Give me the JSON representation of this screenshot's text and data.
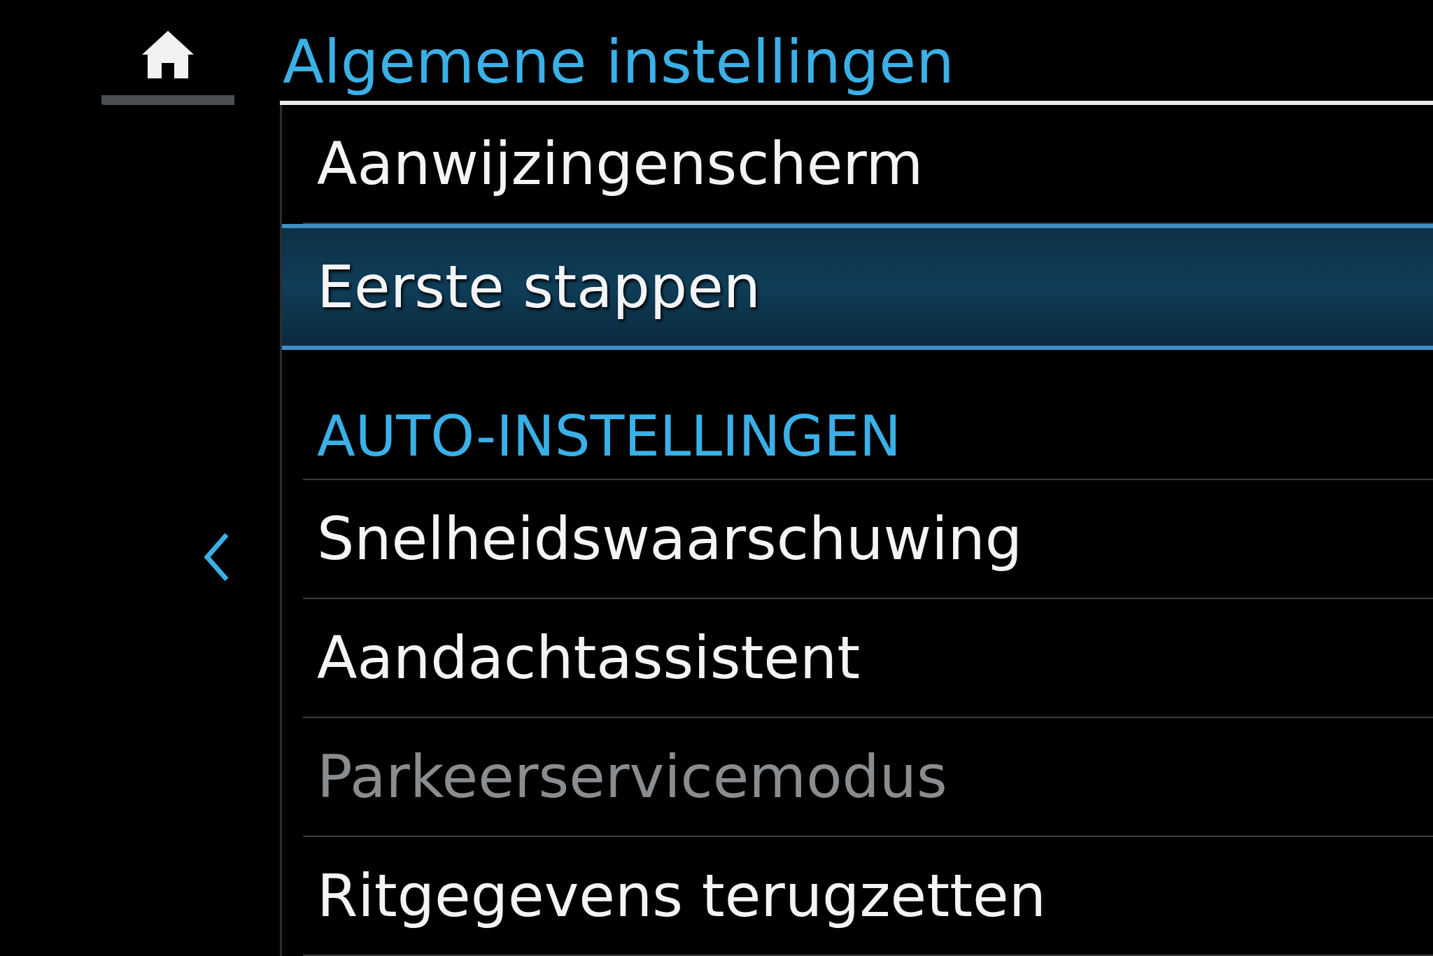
{
  "title": "Algemene instellingen",
  "items": [
    {
      "kind": "item",
      "label": "Aanwijzingenscherm",
      "selected": false,
      "disabled": false
    },
    {
      "kind": "item",
      "label": "Eerste stappen",
      "selected": true,
      "disabled": false
    },
    {
      "kind": "header",
      "label": "AUTO-INSTELLINGEN"
    },
    {
      "kind": "item",
      "label": "Snelheidswaarschuwing",
      "selected": false,
      "disabled": false
    },
    {
      "kind": "item",
      "label": "Aandachtassistent",
      "selected": false,
      "disabled": false
    },
    {
      "kind": "item",
      "label": "Parkeerservicemodus",
      "selected": false,
      "disabled": true
    },
    {
      "kind": "item",
      "label": "Ritgegevens terugzetten",
      "selected": false,
      "disabled": false
    }
  ]
}
